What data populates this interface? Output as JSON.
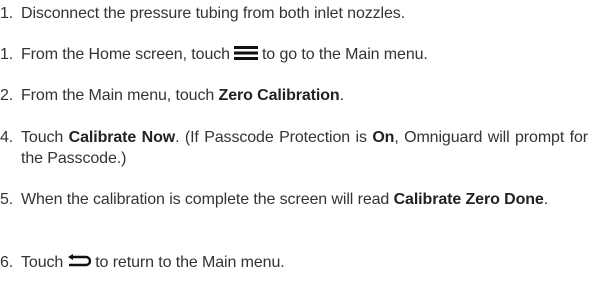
{
  "steps": [
    {
      "number": "1.",
      "text": "Disconnect the pressure tubing from both inlet nozzles."
    },
    {
      "number": "1.",
      "before": "From the Home screen, touch",
      "icon": "menu-icon",
      "after": "to go to the Main menu."
    },
    {
      "number": "2.",
      "before": "From the Main menu, touch",
      "bold": "Zero Calibration",
      "after": "."
    },
    {
      "number": "4.",
      "before": "Touch",
      "bold": "Calibrate Now",
      "middle": ". (If Passcode Protection is",
      "bold2": "On",
      "after": ", Omniguard will prompt for the Passcode.)"
    },
    {
      "number": "5.",
      "before": "When the calibration is complete the screen will read",
      "bold": "Calibrate Zero Done",
      "after": "."
    },
    {
      "number": "6.",
      "before": "Touch",
      "icon": "back-arrow-icon",
      "after": "to return to the Main menu."
    }
  ],
  "colors": {
    "text": "#333333",
    "bold_text": "#222222",
    "icon": "#111111"
  }
}
